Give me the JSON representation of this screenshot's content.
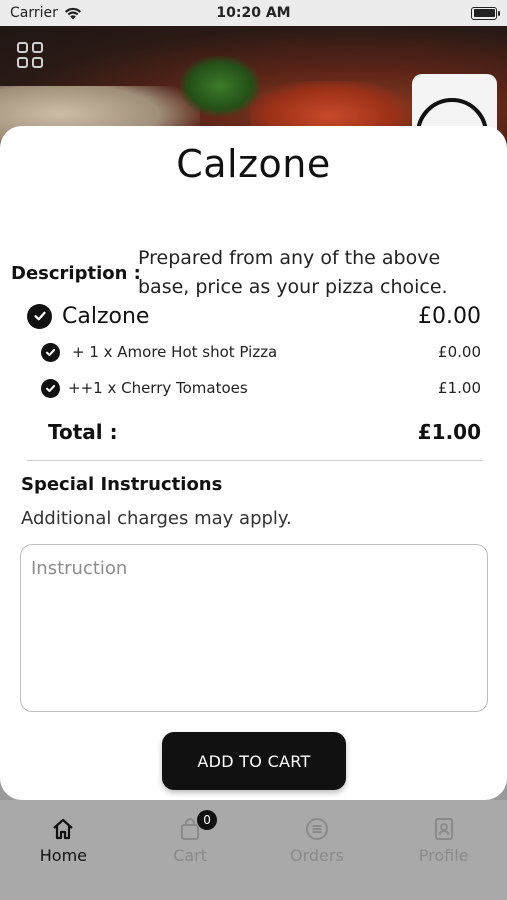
{
  "status_bar": {
    "carrier": "Carrier",
    "time": "10:20 AM"
  },
  "background": {
    "cart_count": "0"
  },
  "tabs": [
    {
      "label": "Home",
      "icon": "home-icon",
      "active": true
    },
    {
      "label": "Cart",
      "icon": "bag-icon",
      "active": false
    },
    {
      "label": "Orders",
      "icon": "orders-icon",
      "active": false
    },
    {
      "label": "Profile",
      "icon": "profile-icon",
      "active": false
    }
  ],
  "modal": {
    "title": "Calzone",
    "description_label": "Description :",
    "description_text": "Prepared from any of the above base, price as your pizza choice.",
    "main_item": {
      "name": "Calzone",
      "price": "£0.00",
      "checked": true
    },
    "options": [
      {
        "name": "+ 1 x Amore Hot shot Pizza",
        "price": "£0.00",
        "checked": true
      },
      {
        "name": "++1 x Cherry Tomatoes",
        "price": "£1.00",
        "checked": true
      }
    ],
    "total_label": "Total :",
    "total_value": "£1.00",
    "special_title": "Special Instructions",
    "special_note": "Additional charges may apply.",
    "instruction_placeholder": "Instruction",
    "instruction_value": "",
    "add_button_label": "ADD TO CART"
  },
  "colors": {
    "primary": "#111111",
    "sheet": "#ffffff",
    "overlay": "#9a9a9a"
  }
}
